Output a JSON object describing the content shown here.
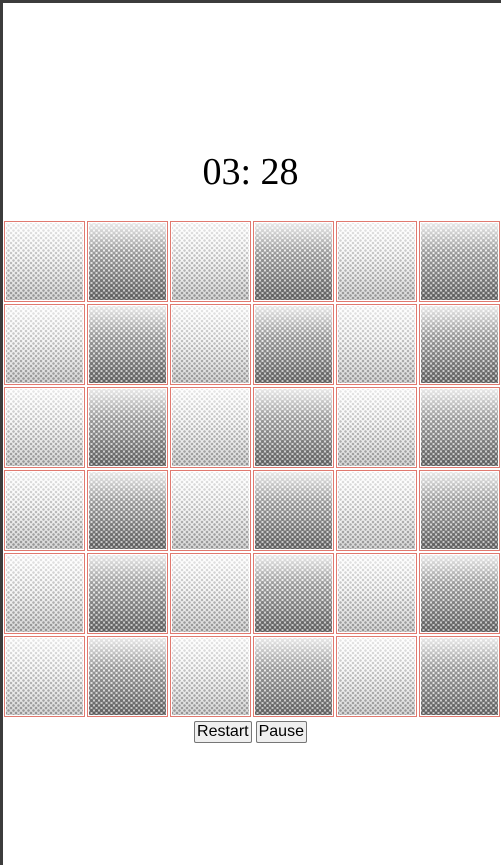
{
  "timer": {
    "display": "03: 28"
  },
  "board": {
    "rows": 6,
    "columns": 6,
    "tiles": [
      [
        "light",
        "dark",
        "light",
        "dark",
        "light",
        "dark"
      ],
      [
        "light",
        "dark",
        "light",
        "dark",
        "light",
        "dark"
      ],
      [
        "light",
        "dark",
        "light",
        "dark",
        "light",
        "dark"
      ],
      [
        "light",
        "dark",
        "light",
        "dark",
        "light",
        "dark"
      ],
      [
        "light",
        "dark",
        "light",
        "dark",
        "light",
        "dark"
      ],
      [
        "light",
        "dark",
        "light",
        "dark",
        "light",
        "dark"
      ]
    ],
    "colors": {
      "tile_border": "#e0796f",
      "pattern": "#5a5a5a"
    }
  },
  "controls": {
    "restart_label": "Restart",
    "pause_label": "Pause"
  }
}
